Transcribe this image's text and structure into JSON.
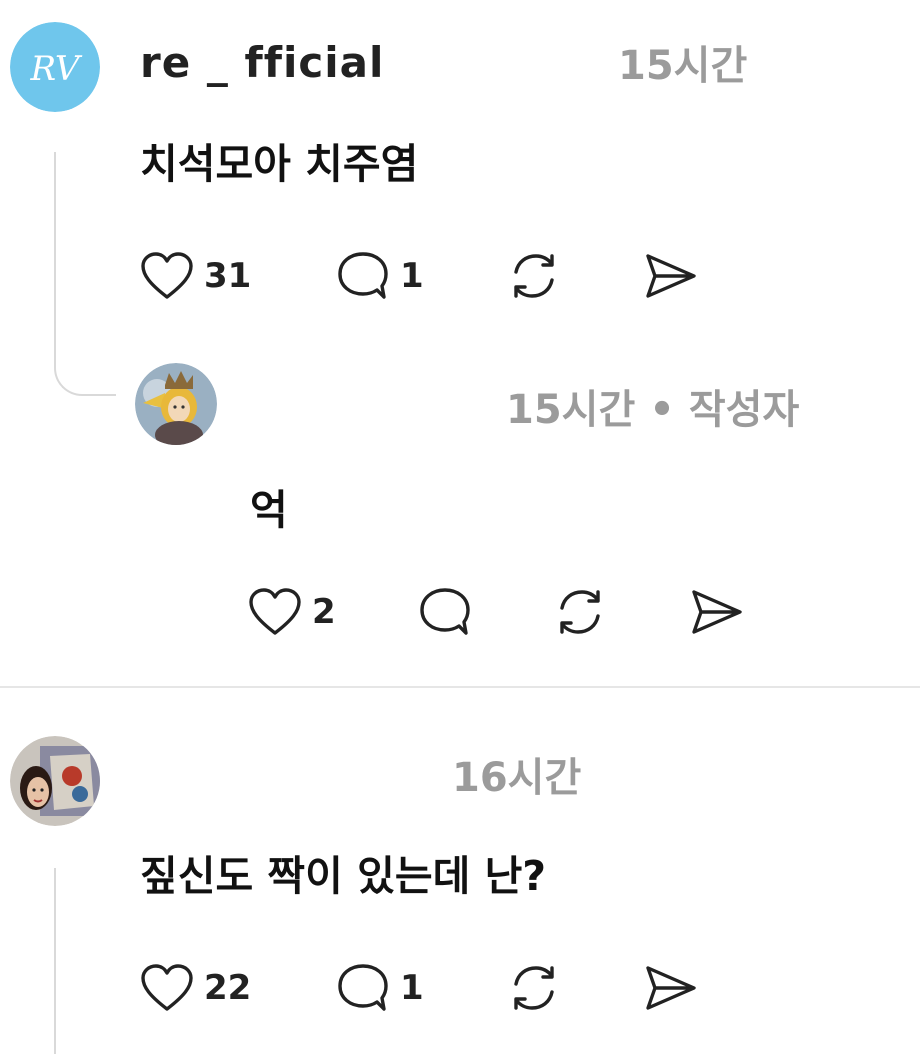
{
  "comments": [
    {
      "username": "re       _  fficial",
      "time": "15시간",
      "text": "치석모아 치주염",
      "likes": "31",
      "replies": "1"
    },
    {
      "username": "                  ",
      "time": "15시간",
      "author_dot": "•",
      "author_label": "작성자",
      "text": "억",
      "likes": "2",
      "replies": ""
    },
    {
      "username": "                 ",
      "time": "16시간",
      "text": "짚신도 짝이 있는데 난?",
      "likes": "22",
      "replies": "1"
    }
  ],
  "icons": {
    "like": "heart-icon",
    "reply": "comment-bubble-icon",
    "repost": "repost-icon",
    "share": "send-icon"
  },
  "avatar_monogram": "RV",
  "colors": {
    "timestamp": "#9b9b9b",
    "text": "#111111",
    "thread_line": "#d9d9d9",
    "avatar1_bg": "#6fc6ec"
  }
}
